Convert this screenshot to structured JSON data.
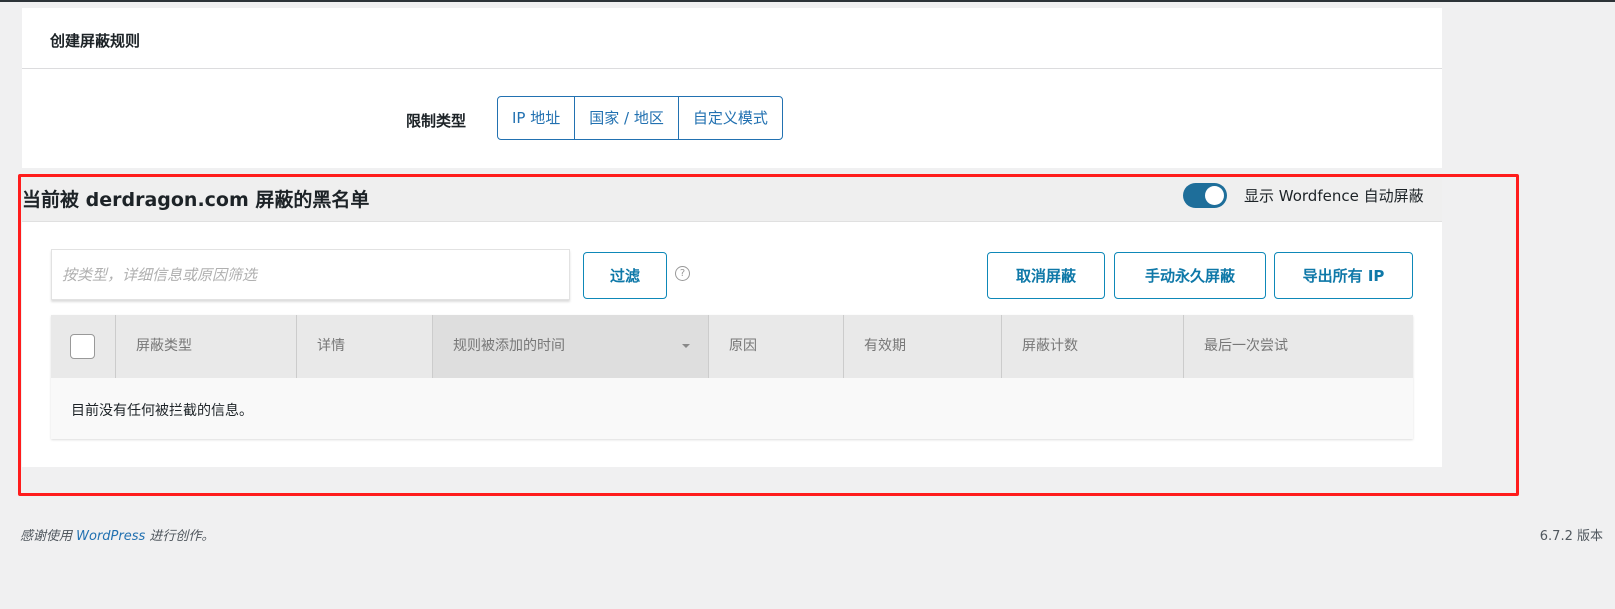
{
  "create_rule": {
    "title": "创建屏蔽规则",
    "restriction_label": "限制类型",
    "options": [
      "IP 地址",
      "国家 / 地区",
      "自定义模式"
    ]
  },
  "blacklist": {
    "title": "当前被 derdragon.com 屏蔽的黑名单",
    "toggle_label": "显示 Wordfence 自动屏蔽",
    "toggle_on": true,
    "search_placeholder": "按类型，详细信息或原因筛选",
    "filter_button": "过滤",
    "help_icon": "?",
    "buttons": {
      "unblock": "取消屏蔽",
      "block_permanently": "手动永久屏蔽",
      "export_ips": "导出所有 IP"
    },
    "columns": [
      "屏蔽类型",
      "详情",
      "规则被添加的时间",
      "原因",
      "有效期",
      "屏蔽计数",
      "最后一次尝试"
    ],
    "empty_message": "目前没有任何被拦截的信息。"
  },
  "footer": {
    "thanks_prefix": "感谢使用 ",
    "link": "WordPress",
    "thanks_suffix": " 进行创作。",
    "version": "6.7.2 版本"
  }
}
